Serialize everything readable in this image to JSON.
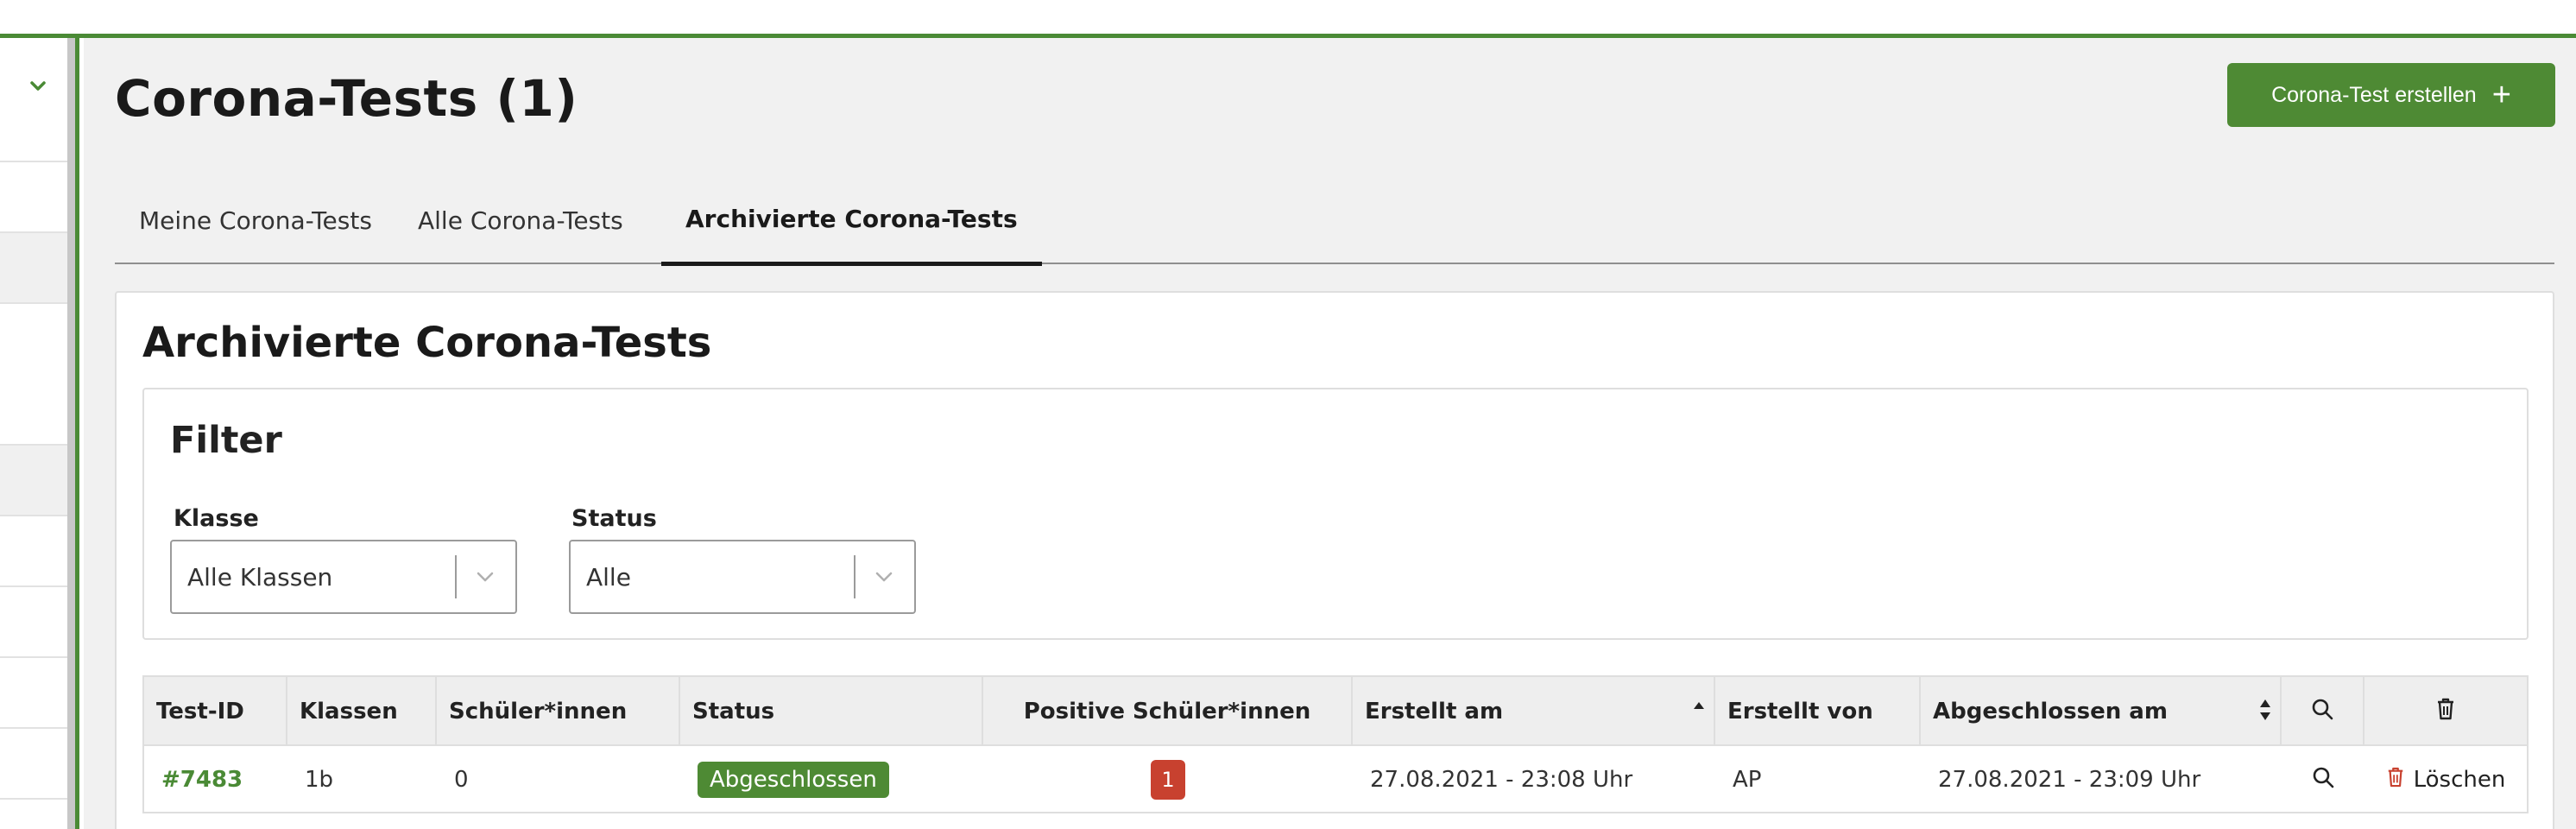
{
  "page": {
    "title": "Corona-Tests (1)",
    "create_button": "Corona-Test erstellen",
    "create_icon": "+"
  },
  "tabs": [
    {
      "label": "Meine Corona-Tests",
      "active": false
    },
    {
      "label": "Alle Corona-Tests",
      "active": false
    },
    {
      "label": "Archivierte Corona-Tests",
      "active": true
    }
  ],
  "card": {
    "title": "Archivierte Corona-Tests"
  },
  "filter": {
    "title": "Filter",
    "klasse_label": "Klasse",
    "klasse_value": "Alle Klassen",
    "status_label": "Status",
    "status_value": "Alle"
  },
  "table": {
    "headers": [
      "Test-ID",
      "Klassen",
      "Schüler*innen",
      "Status",
      "Positive Schüler*innen",
      "Erstellt am",
      "Erstellt von",
      "Abgeschlossen am"
    ],
    "rows": [
      {
        "id": "#7483",
        "klassen": "1b",
        "schueler": "0",
        "status": "Abgeschlossen",
        "positive": "1",
        "erstellt_am": "27.08.2021 - 23:08 Uhr",
        "erstellt_von": "AP",
        "abgeschlossen_am": "27.08.2021 - 23:09 Uhr",
        "delete_label": "Löschen"
      }
    ]
  },
  "colors": {
    "accent": "#4e8a34",
    "danger": "#c8412f"
  }
}
